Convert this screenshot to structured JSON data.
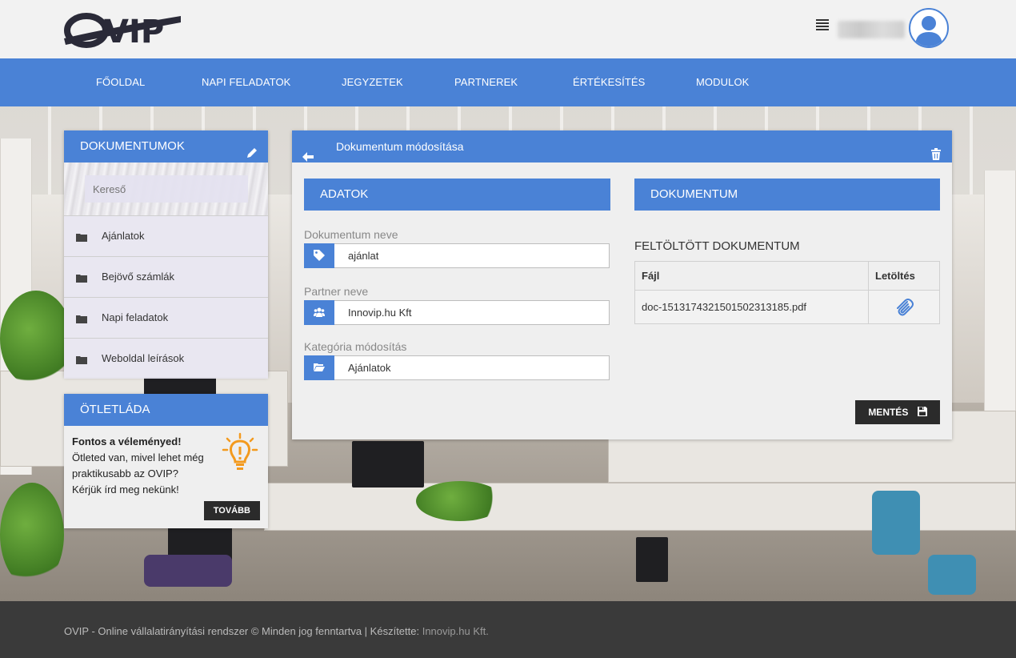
{
  "header": {
    "logo_text": "OVIP",
    "menu_icon": "list-icon",
    "user_icon": "user-avatar-icon"
  },
  "nav": {
    "items": [
      {
        "label": "Főoldal"
      },
      {
        "label": "Napi feladatok"
      },
      {
        "label": "Jegyzetek"
      },
      {
        "label": "Partnerek"
      },
      {
        "label": "Értékesítés"
      },
      {
        "label": "Modulok"
      }
    ]
  },
  "documents_panel": {
    "title": "Dokumentumok",
    "search_placeholder": "Kereső",
    "items": [
      {
        "label": "Ajánlatok"
      },
      {
        "label": "Bejövő számlák"
      },
      {
        "label": "Napi feladatok"
      },
      {
        "label": "Weboldal leírások"
      }
    ]
  },
  "ideas_panel": {
    "title": "Ötletláda",
    "heading": "Fontos a véleményed!",
    "line1": "Ötleted van, mivel lehet még",
    "line2": "praktikusabb az OVIP?",
    "line3": "Kérjük írd meg nekünk!",
    "button": "Tovább"
  },
  "main": {
    "title": "Dokumentum módosítása",
    "data_section": {
      "title": "Adatok",
      "name_label": "Dokumentum neve",
      "name_value": "ajánlat",
      "partner_label": "Partner neve",
      "partner_value": "Innovip.hu Kft",
      "category_label": "Kategória módosítás",
      "category_value": "Ajánlatok"
    },
    "doc_section": {
      "title": "Dokumentum",
      "uploaded_title": "Feltöltött dokumentum",
      "col_file": "Fájl",
      "col_download": "Letöltés",
      "file_name": "doc-1513174321501502313185.pdf"
    },
    "save_button": "Mentés"
  },
  "footer": {
    "text": "OVIP - Online vállalatirányítási rendszer © Minden jog fenntartva | Készítette: ",
    "link": "Innovip.hu Kft."
  },
  "colors": {
    "accent": "#4a82d6",
    "dark_button": "#2b2b2b",
    "footer_bg": "#3a3a3a"
  }
}
